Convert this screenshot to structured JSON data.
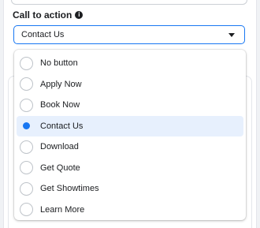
{
  "cta": {
    "label": "Call to action",
    "info_icon": "i",
    "selected_value": "Contact Us",
    "options": [
      {
        "label": "No button",
        "selected": false
      },
      {
        "label": "Apply Now",
        "selected": false
      },
      {
        "label": "Book Now",
        "selected": false
      },
      {
        "label": "Contact Us",
        "selected": true
      },
      {
        "label": "Download",
        "selected": false
      },
      {
        "label": "Get Quote",
        "selected": false
      },
      {
        "label": "Get Showtimes",
        "selected": false
      },
      {
        "label": "Learn More",
        "selected": false
      }
    ]
  },
  "colors": {
    "accent": "#1877f2",
    "selected_bg": "#e7f0fd",
    "border": "#ccd0d5",
    "text": "#1c1e21"
  },
  "icons": {
    "info": "info-icon",
    "caret": "caret-down-icon",
    "radio": "radio-icon"
  }
}
